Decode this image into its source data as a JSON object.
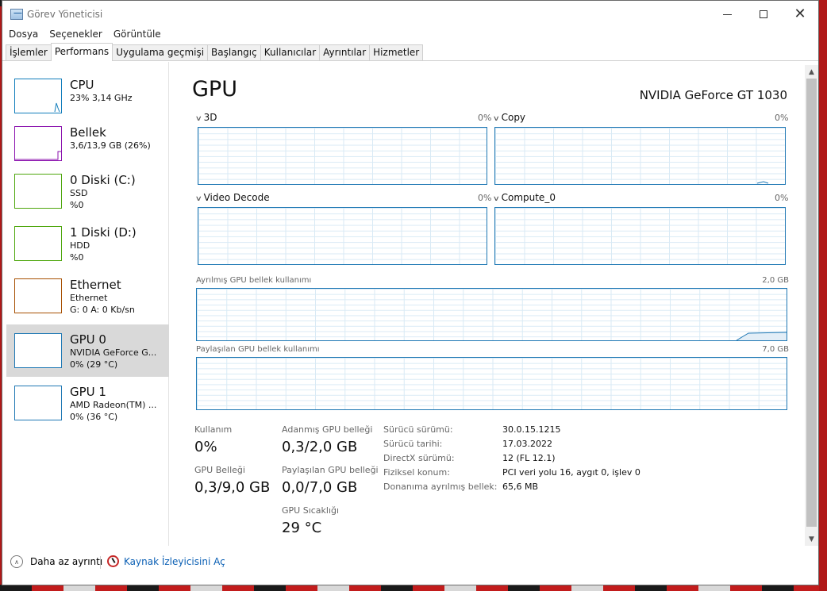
{
  "window": {
    "title": "Görev Yöneticisi",
    "controls": {
      "minimize": "minimize",
      "maximize": "maximize",
      "close": "close"
    }
  },
  "menu": [
    "Dosya",
    "Seçenekler",
    "Görüntüle"
  ],
  "tabs": [
    "İşlemler",
    "Performans",
    "Uygulama geçmişi",
    "Başlangıç",
    "Kullanıcılar",
    "Ayrıntılar",
    "Hizmetler"
  ],
  "active_tab": "Performans",
  "sidebar": [
    {
      "title": "CPU",
      "line1": "23% 3,14 GHz",
      "line2": "",
      "color": "#117dbb"
    },
    {
      "title": "Bellek",
      "line1": "3,6/13,9 GB (26%)",
      "line2": "",
      "color": "#8b12ae"
    },
    {
      "title": "0 Diski (C:)",
      "line1": "SSD",
      "line2": "%0",
      "color": "#4da60c"
    },
    {
      "title": "1 Diski (D:)",
      "line1": "HDD",
      "line2": "%0",
      "color": "#4da60c"
    },
    {
      "title": "Ethernet",
      "line1": "Ethernet",
      "line2_prefix": "G: 0 A: 0 Kb/sn",
      "color": "#a74f01"
    },
    {
      "title": "GPU 0",
      "line1": "NVIDIA GeForce G...",
      "line2": "0% (29 °C)",
      "color": "#1f78b4",
      "selected": true
    },
    {
      "title": "GPU 1",
      "line1": "AMD Radeon(TM) ...",
      "line2": "0% (36 °C)",
      "color": "#1f78b4"
    }
  ],
  "gpu": {
    "heading": "GPU",
    "name": "NVIDIA GeForce GT 1030",
    "engines": [
      {
        "label": "3D",
        "percent": "0%"
      },
      {
        "label": "Copy",
        "percent": "0%"
      },
      {
        "label": "Video Decode",
        "percent": "0%"
      },
      {
        "label": "Compute_0",
        "percent": "0%"
      }
    ],
    "dedicated_mem": {
      "label": "Ayrılmış GPU bellek kullanımı",
      "max": "2,0 GB"
    },
    "shared_mem": {
      "label": "Paylaşılan GPU bellek kullanımı",
      "max": "7,0 GB"
    },
    "stats": {
      "usage_label": "Kullanım",
      "usage_value": "0%",
      "gpu_mem_label": "GPU Belleği",
      "gpu_mem_value": "0,3/9,0 GB",
      "dedicated_label": "Adanmış GPU belleği",
      "dedicated_value": "0,3/2,0 GB",
      "shared_label": "Paylaşılan GPU belleği",
      "shared_value": "0,0/7,0 GB",
      "temp_label": "GPU Sıcaklığı",
      "temp_value": "29 °C"
    },
    "info": [
      {
        "label": "Sürücü sürümü:",
        "value": "30.0.15.1215"
      },
      {
        "label": "Sürücü tarihi:",
        "value": "17.03.2022"
      },
      {
        "label": "DirectX sürümü:",
        "value": "12 (FL 12.1)"
      },
      {
        "label": "Fiziksel konum:",
        "value": "PCI veri yolu 16, aygıt 0, işlev 0"
      },
      {
        "label": "Donanıma ayrılmış bellek:",
        "value": "65,6 MB"
      }
    ]
  },
  "footer": {
    "fewer_details": "Daha az ayrıntı",
    "resource_monitor": "Kaynak İzleyicisini Aç"
  }
}
